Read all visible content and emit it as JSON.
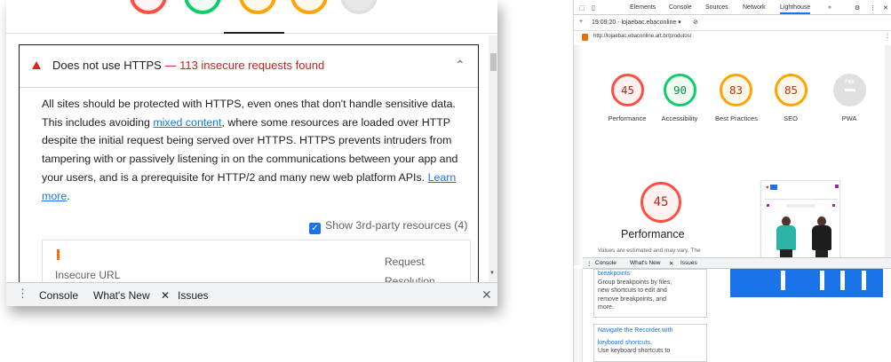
{
  "left": {
    "audit": {
      "title": "Does not use HTTPS",
      "separator": "—",
      "subtitle": "113 insecure requests found",
      "desc_part1": "All sites should be protected with HTTPS, even ones that don't handle sensitive data. This includes avoiding ",
      "desc_link1": "mixed content",
      "desc_part2": ", where some resources are loaded over HTTP despite the initial request being served over HTTPS. HTTPS prevents intruders from tampering with or passively listening in on the communications between your app and your users, and is a prerequisite for HTTP/2 and many new web platform APIs. ",
      "desc_link2": "Learn more",
      "desc_end": "."
    },
    "checkbox_label": "Show 3rd-party resources (4)",
    "table": {
      "col_url": "Insecure URL",
      "col_req_1": "Request",
      "col_req_2": "Resolution"
    },
    "drawer": {
      "console": "Console",
      "whats_new": "What's New",
      "issues": "Issues"
    }
  },
  "right": {
    "toolbar": {
      "elements": "Elements",
      "console": "Console",
      "sources": "Sources",
      "network": "Network",
      "lighthouse": "Lighthouse",
      "more": "»"
    },
    "report_select": "19:09:20 - lojaebac.ebaconline ▾",
    "url": "http://lojaebac.ebaconline.art.br/produtos/",
    "scores": [
      {
        "label": "Performance",
        "value": "45"
      },
      {
        "label": "Accessibility",
        "value": "90"
      },
      {
        "label": "Best Practices",
        "value": "83"
      },
      {
        "label": "SEO",
        "value": "85"
      },
      {
        "label": "PWA",
        "value": "PWA"
      }
    ],
    "perf_big": "45",
    "perf_title": "Performance",
    "perf_note": "Values are estimated and may vary. The",
    "drawer": {
      "console": "Console",
      "whats_new": "What's New",
      "issues": "Issues"
    },
    "whats_new": {
      "card1_line0": "breakpoints",
      "card1_line1": "Group breakpoints by files,",
      "card1_line2": "new shortcuts to edit and",
      "card1_line3": "remove breakpoints, and",
      "card1_line4": "more.",
      "card2_title1": "Navigate the Recorder with",
      "card2_title2": "keyboard shortcuts.",
      "card2_line1": "Use keyboard shortcuts to"
    }
  }
}
